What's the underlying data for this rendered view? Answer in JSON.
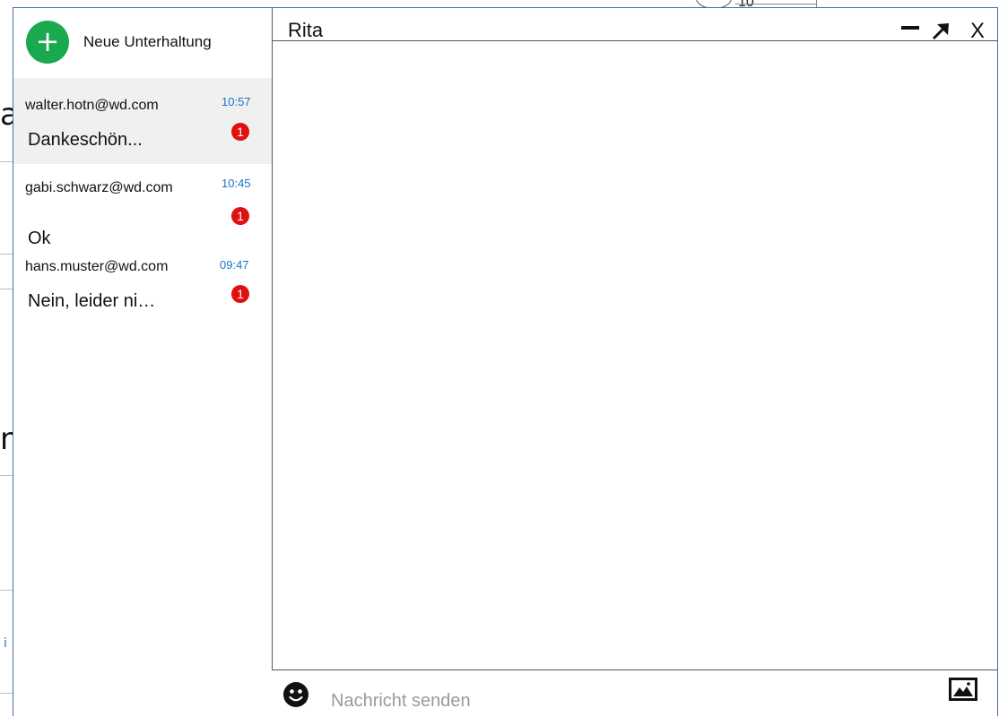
{
  "background": {
    "fragment_a": "a",
    "fragment_n": "n",
    "fragment_i": "i",
    "top_number": "10"
  },
  "sidebar": {
    "new_conversation_label": "Neue Unterhaltung",
    "conversations": [
      {
        "email": "walter.hotn@wd.com",
        "time": "10:57",
        "unread": "1",
        "preview": "Dankeschön...",
        "active": true
      },
      {
        "email": "gabi.schwarz@wd.com",
        "time": "10:45",
        "unread": "1",
        "preview": "Ok",
        "active": false
      },
      {
        "email": "hans.muster@wd.com",
        "time": "09:47",
        "unread": "1",
        "preview": "Nein, leider ni…",
        "active": false
      }
    ]
  },
  "chat": {
    "title": "Rita",
    "close_label": "X",
    "input_placeholder": "Nachricht senden"
  },
  "colors": {
    "accent_green": "#1aa94f",
    "badge_red": "#e01010",
    "time_blue": "#1a73c8"
  },
  "icons": [
    "plus-icon",
    "minimize-icon",
    "expand-icon",
    "close-icon",
    "emoji-icon",
    "image-icon"
  ]
}
